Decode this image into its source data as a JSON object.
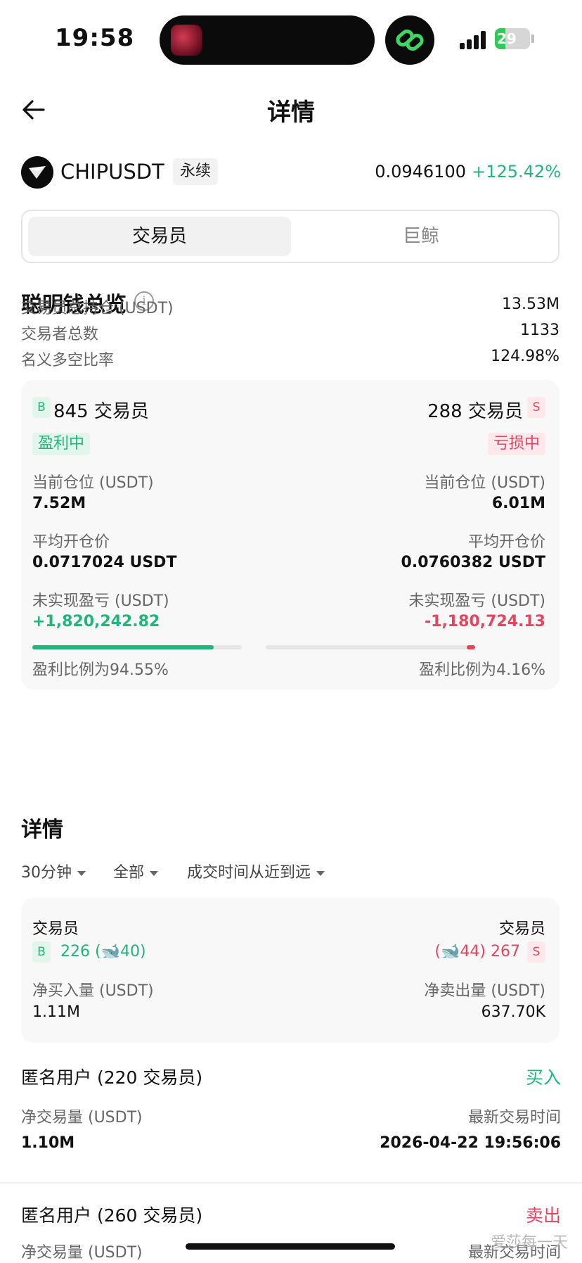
{
  "status_bar": {
    "time": "19:58",
    "battery": "29",
    "battery_level": 0.29,
    "icons": [
      "island-thumbnail-icon",
      "link-icon",
      "signal-icon",
      "battery-icon"
    ]
  },
  "header": {
    "title": "详情",
    "back_icon": "arrow-left-icon"
  },
  "pair": {
    "symbol": "CHIPUSDT",
    "type": "永续",
    "price": "0.0946100",
    "change": "+125.42%"
  },
  "tabs": [
    {
      "label": "交易员",
      "active": true
    },
    {
      "label": "巨鲸",
      "active": false
    }
  ],
  "overview": {
    "title": "聪明钱总览",
    "info_icon": "ⓘ",
    "rows": [
      {
        "label": "交易员总持仓 (USDT)",
        "value": "13.53M"
      },
      {
        "label": "交易者总数",
        "value": "1133"
      },
      {
        "label": "名义多空比率",
        "value": "124.98%"
      }
    ]
  },
  "long_short": {
    "long": {
      "badge": "B",
      "count_label": "845 交易员",
      "status": "盈利中",
      "position_label": "当前仓位 (USDT)",
      "position": "7.52M",
      "avg_label": "平均开仓价",
      "avg_price": "0.0717024 USDT",
      "pnl_label": "未实现盈亏 (USDT)",
      "pnl": "+1,820,242.82",
      "ratio_text": "盈利比例为94.55%",
      "ratio": 0.8667
    },
    "short": {
      "badge": "S",
      "count_label": "288 交易员",
      "status": "亏损中",
      "position_label": "当前仓位 (USDT)",
      "position": "6.01M",
      "avg_label": "平均开仓价",
      "avg_price": "0.0760382 USDT",
      "pnl_label": "未实现盈亏 (USDT)",
      "pnl": "-1,180,724.13",
      "ratio_text": "盈利比例为4.16%",
      "ratio": 0.0416
    }
  },
  "details": {
    "title": "详情",
    "filters": [
      {
        "label": "30分钟"
      },
      {
        "label": "全部"
      },
      {
        "label": "成交时间从近到远"
      }
    ],
    "summary": {
      "buy_header": "交易员",
      "sell_header": "交易员",
      "buy_count": "226",
      "buy_whales": "40",
      "buy_badge": "B",
      "sell_count": "267",
      "sell_whales": "44",
      "sell_badge": "S",
      "buy_label": "净买入量 (USDT)",
      "buy_value": "1.11M",
      "sell_label": "净卖出量 (USDT)",
      "sell_value": "637.70K"
    },
    "entries": [
      {
        "title": "匿名用户 (220 交易员)",
        "action": "买入",
        "vol_label": "净交易量 (USDT)",
        "vol": "1.10M",
        "time_label": "最新交易时间",
        "time": "2026-04-22 19:56:06"
      },
      {
        "title": "匿名用户 (260 交易员)",
        "action": "卖出",
        "vol_label": "净交易量 (USDT)",
        "time_label": "最新交易时间"
      }
    ]
  },
  "watermark": "爱莎每一天",
  "colors": {
    "green": "#1fb67b",
    "red": "#e5455f",
    "text": "#111111",
    "muted": "#666666"
  }
}
